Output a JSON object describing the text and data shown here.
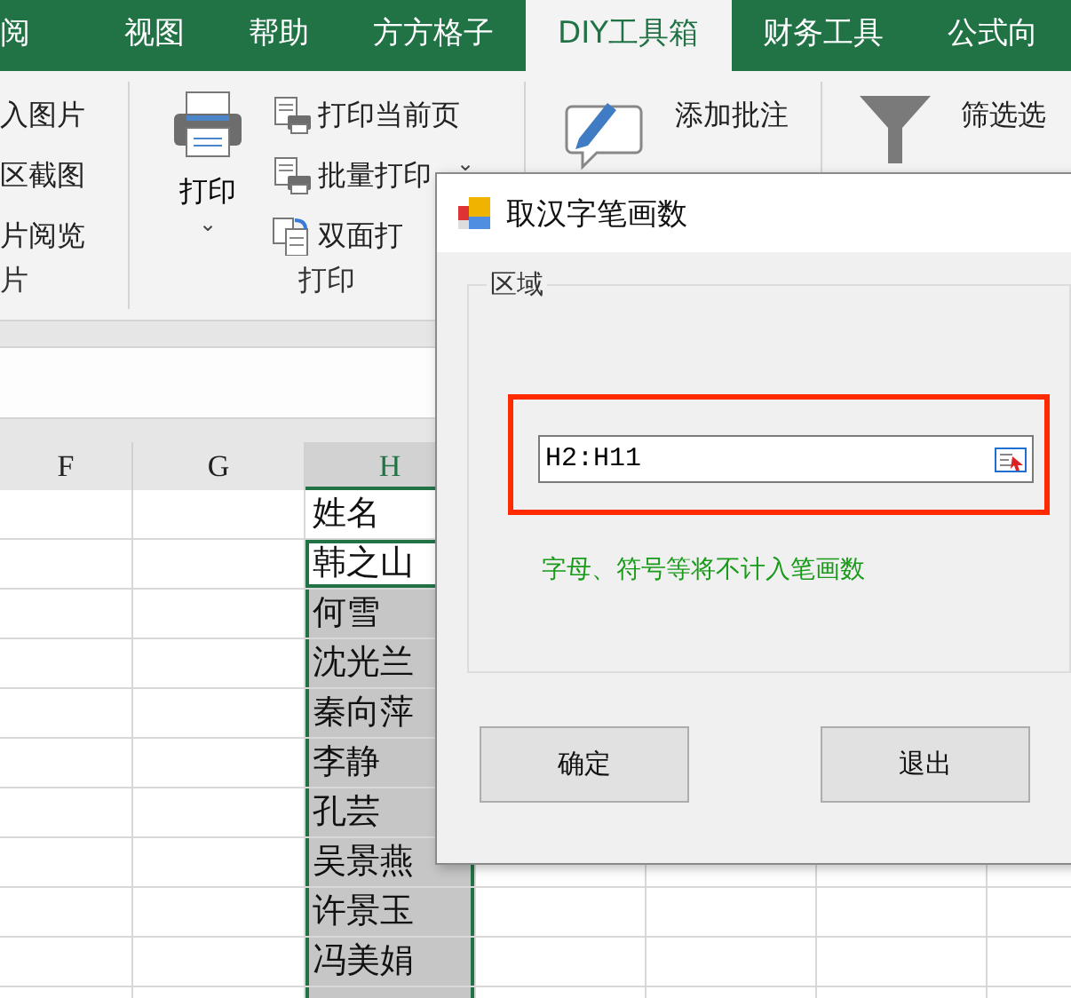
{
  "ribbon_tabs": [
    {
      "label": "阅",
      "selected": false
    },
    {
      "label": "视图",
      "selected": false
    },
    {
      "label": "帮助",
      "selected": false
    },
    {
      "label": "方方格子",
      "selected": false
    },
    {
      "label": "DIY工具箱",
      "selected": true
    },
    {
      "label": "财务工具",
      "selected": false
    },
    {
      "label": "公式向",
      "selected": false
    }
  ],
  "ribbon_groups": [
    {
      "kind": "list",
      "items": [
        {
          "label": "入图片"
        },
        {
          "label": "区截图"
        },
        {
          "label": "片阅览"
        }
      ],
      "label": "片"
    },
    {
      "kind": "print",
      "big_button": {
        "label": "打印",
        "caret": "⌄"
      },
      "items": [
        {
          "label": "打印当前页"
        },
        {
          "label": "批量打印",
          "caret": "⌄"
        },
        {
          "label": "双面打"
        }
      ],
      "label": "打印"
    },
    {
      "kind": "comment",
      "items": [
        {
          "label": "添加批注"
        }
      ]
    },
    {
      "kind": "filter",
      "items": [
        {
          "label": "筛选选"
        }
      ]
    }
  ],
  "sheet": {
    "columns": [
      {
        "label": "F",
        "selected": false
      },
      {
        "label": "G",
        "selected": false
      },
      {
        "label": "H",
        "selected": true
      }
    ],
    "column_h_cells": [
      {
        "text": "姓名",
        "selected": false,
        "active": false
      },
      {
        "text": "韩之山",
        "selected": true,
        "active": true
      },
      {
        "text": "何雪",
        "selected": true,
        "active": false
      },
      {
        "text": "沈光兰",
        "selected": true,
        "active": false
      },
      {
        "text": "秦向萍",
        "selected": true,
        "active": false
      },
      {
        "text": "李静",
        "selected": true,
        "active": false
      },
      {
        "text": "孔芸",
        "selected": true,
        "active": false
      },
      {
        "text": "吴景燕",
        "selected": true,
        "active": false
      },
      {
        "text": "许景玉",
        "selected": true,
        "active": false
      },
      {
        "text": "冯美娟",
        "selected": true,
        "active": false
      }
    ]
  },
  "dialog": {
    "title": "取汉字笔画数",
    "group_label": "区域",
    "range_field": {
      "value": "H2:H11",
      "highlighted": true
    },
    "hint": "字母、符号等将不计入笔画数",
    "buttons": [
      "确定",
      "退出"
    ]
  }
}
